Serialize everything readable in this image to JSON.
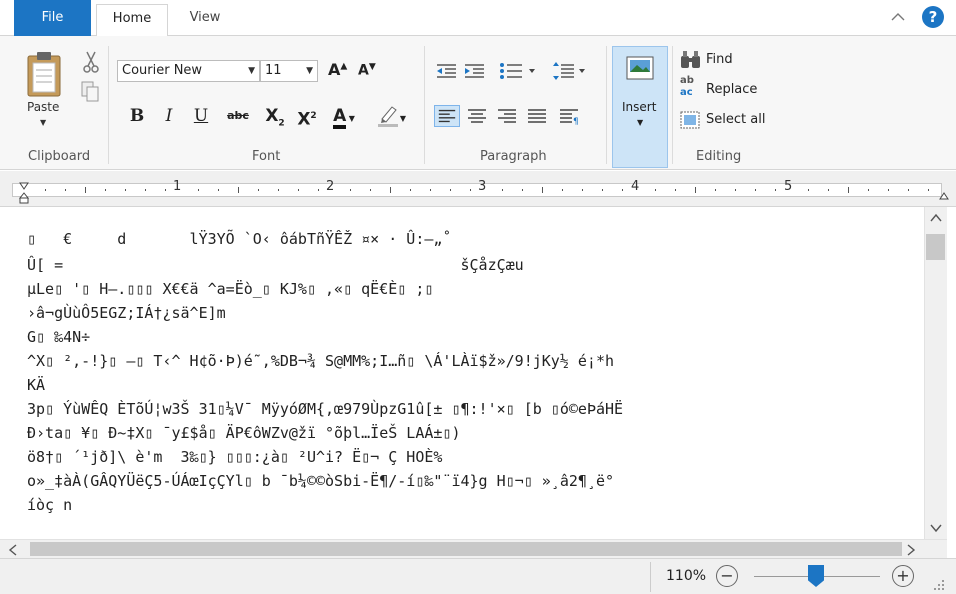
{
  "tabs": {
    "file": "File",
    "home": "Home",
    "view": "View"
  },
  "clipboard": {
    "paste": "Paste",
    "group": "Clipboard"
  },
  "font": {
    "name": "Courier New",
    "size": "11",
    "bold": "B",
    "italic": "I",
    "underline": "U",
    "strike": "abc",
    "group": "Font"
  },
  "paragraph": {
    "group": "Paragraph"
  },
  "insert": {
    "label": "Insert"
  },
  "editing": {
    "find": "Find",
    "replace": "Replace",
    "select_all": "Select all",
    "group": "Editing"
  },
  "ruler": {
    "marks": [
      "1",
      "2",
      "3",
      "4",
      "5"
    ]
  },
  "document": {
    "lines": [
      "▯   €     d       lŸ3YÕ `O‹ ôábTñŸÊŽ ¤× · Û:—„˚",
      "Û[ =                                            šÇåzÇæu",
      "µLe▯ '▯ H–.▯▯▯ X€€ä ^a=Ëò_▯ KJ%▯ ,«▯ qË€È▯ ;▯",
      "›â¬gÙùÔ5EGZ;IÁ†¿sä^E]m",
      "G▯ ‰4N÷",
      "^X▯ ²,-!}▯ –▯ T‹^ H¢õ·Þ)é˜,%DB¬¾ S@MM%;I…ñ▯ \\Á'LÀï$ž»/9!jKy½ é¡*h",
      "KÄ",
      "3p▯ ÝùWÊQ ÈTõÚ¦w3Š 31▯¼V¯ MÿyóØM{,œ979ÙpzG1û[± ▯¶:!'×▯ [b ▯ó©eÞáHË",
      "Ð›ta▯ ¥▯ Ð~‡X▯ ¯y£$å▯ ÄP€ôWZv@žï °õþl…ÏeŠ LAÁ±▯)",
      "ö8†▯ ´¹jð]\\ è'm  3‰▯} ▯▯▯:¿à▯ ²U^i? Ë▯¬ Ç HOÈ%",
      "o»_‡àÀ(GÂQYÜëÇ5-ÚÁœIçÇYl▯ b ¯b¼©©òSbi-Ë¶/-í▯‰\"¨ï4}g H▯¬▯ »¸â2¶¸ë°",
      "íòç n"
    ]
  },
  "status": {
    "zoom": "110%"
  },
  "colors": {
    "accent": "#1c75c4"
  }
}
